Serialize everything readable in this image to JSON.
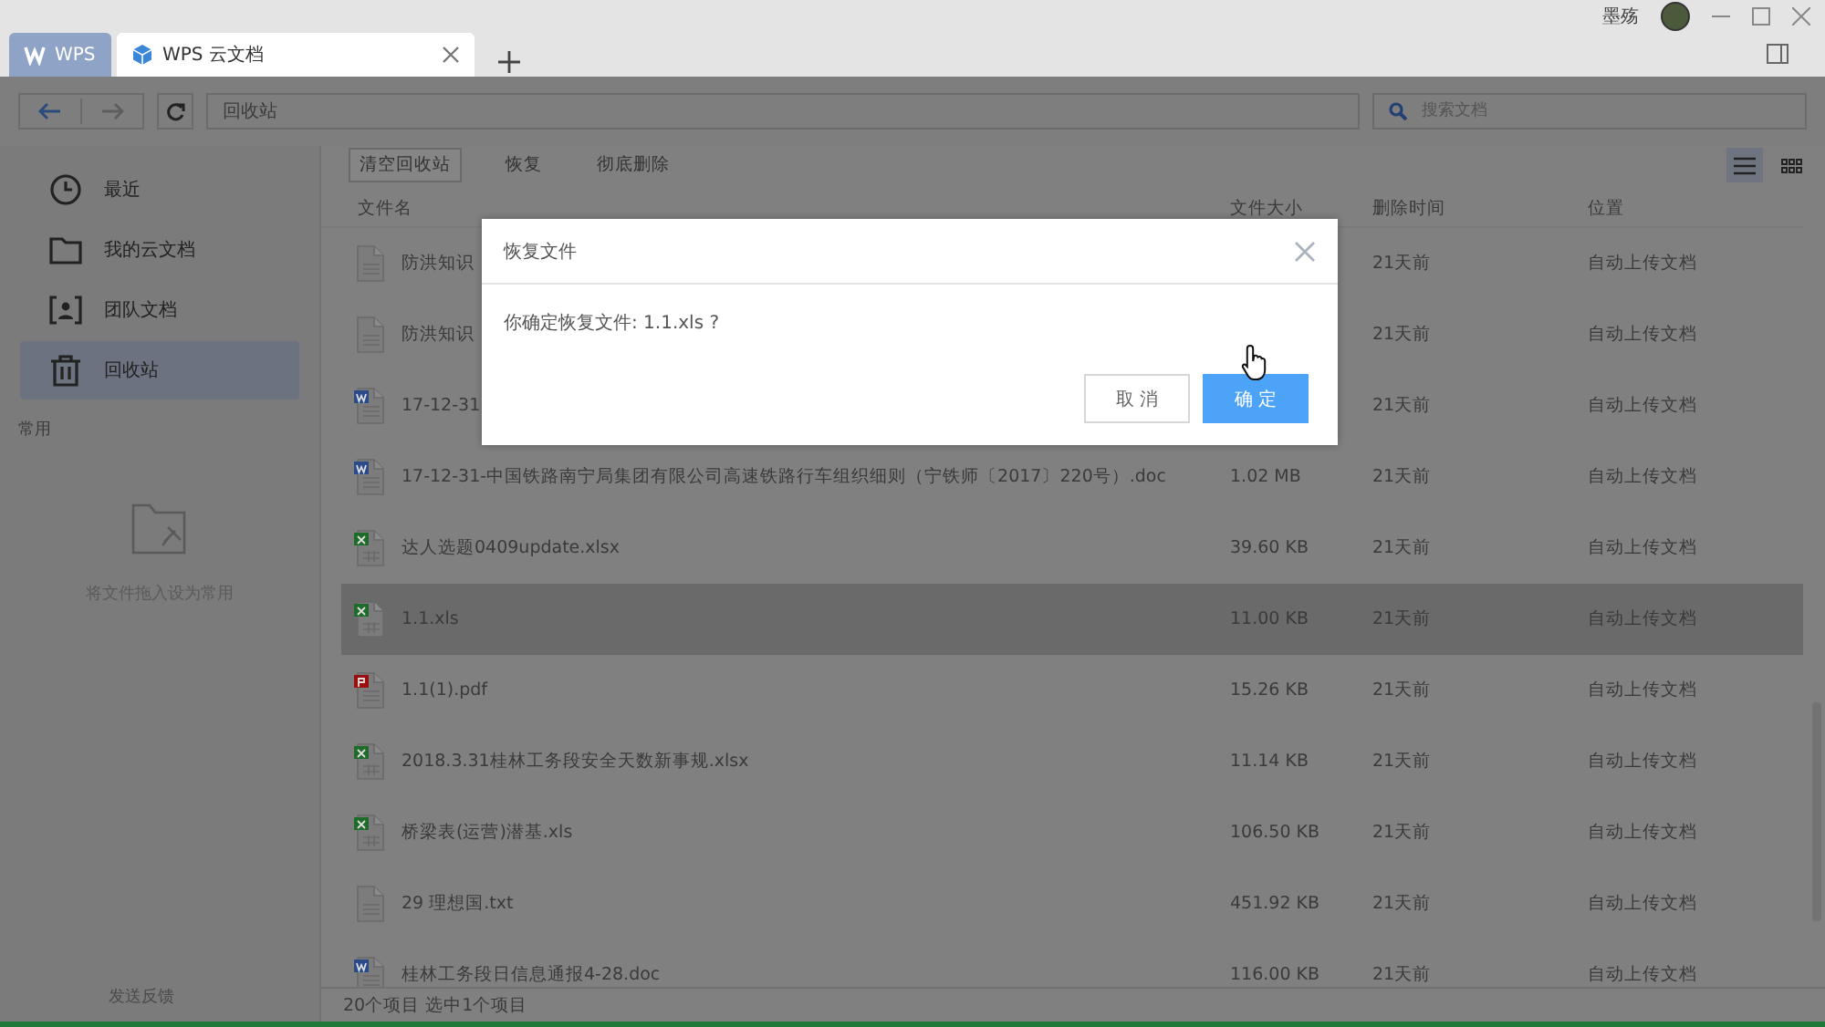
{
  "tabs": [
    {
      "label": "WPS",
      "kind": "home",
      "selected": false
    },
    {
      "label": "WPS 云文档",
      "kind": "doc",
      "selected": true
    }
  ],
  "user": {
    "name": "墨殇"
  },
  "address": "回收站",
  "search": {
    "placeholder": "搜索文档"
  },
  "sidebar": {
    "items": [
      {
        "label": "最近",
        "kind": "clock",
        "selected": false
      },
      {
        "label": "我的云文档",
        "kind": "folder",
        "selected": false
      },
      {
        "label": "团队文档",
        "kind": "team",
        "selected": false
      },
      {
        "label": "回收站",
        "kind": "trash",
        "selected": true
      }
    ],
    "section": "常用",
    "empty_hint": "将文件拖入设为常用",
    "feedback": "发送反馈"
  },
  "toolbar": [
    {
      "label": "清空回收站",
      "outlined": true
    },
    {
      "label": "恢复",
      "outlined": false
    },
    {
      "label": "彻底删除",
      "outlined": false
    }
  ],
  "views": [
    {
      "kind": "list",
      "selected": true
    },
    {
      "kind": "grid",
      "selected": false
    }
  ],
  "table": {
    "columns": [
      "文件名",
      "文件大小",
      "删除时间",
      "位置"
    ],
    "rows": [
      {
        "name": "防洪知识",
        "kind": "txt",
        "deleted": "21天前",
        "location": "自动上传文档",
        "selected": false
      },
      {
        "name": "防洪知识",
        "kind": "txt",
        "deleted": "21天前",
        "location": "自动上传文档",
        "selected": false
      },
      {
        "name": "17-12-31",
        "kind": "doc",
        "deleted": "21天前",
        "location": "自动上传文档",
        "selected": false
      },
      {
        "name": "17-12-31-中国铁路南宁局集团有限公司高速铁路行车组织细则（宁铁师〔2017〕220号）.doc",
        "kind": "doc",
        "size": "1.02 MB",
        "deleted": "21天前",
        "location": "自动上传文档",
        "selected": false
      },
      {
        "name": "达人选题0409update.xlsx",
        "kind": "xls",
        "size": "39.60 KB",
        "deleted": "21天前",
        "location": "自动上传文档",
        "selected": false
      },
      {
        "name": "1.1.xls",
        "kind": "xls",
        "size": "11.00 KB",
        "deleted": "21天前",
        "location": "自动上传文档",
        "selected": true
      },
      {
        "name": "1.1(1).pdf",
        "kind": "pdf",
        "size": "15.26 KB",
        "deleted": "21天前",
        "location": "自动上传文档",
        "selected": false
      },
      {
        "name": "2018.3.31桂林工务段安全天数新事规.xlsx",
        "kind": "xls",
        "size": "11.14 KB",
        "deleted": "21天前",
        "location": "自动上传文档",
        "selected": false
      },
      {
        "name": "桥梁表(运营)潜基.xls",
        "kind": "xls",
        "size": "106.50 KB",
        "deleted": "21天前",
        "location": "自动上传文档",
        "selected": false
      },
      {
        "name": "29 理想国.txt",
        "kind": "txt",
        "size": "451.92 KB",
        "deleted": "21天前",
        "location": "自动上传文档",
        "selected": false
      },
      {
        "name": "桂林工务段日信息通报4-28.doc",
        "kind": "doc",
        "size": "116.00 KB",
        "deleted": "21天前",
        "location": "自动上传文档",
        "selected": false
      }
    ]
  },
  "status": "20个项目 选中1个项目",
  "dialog": {
    "title": "恢复文件",
    "message": "你确定恢复文件: 1.1.xls ?",
    "buttons": [
      {
        "label": "取 消",
        "primary": false
      },
      {
        "label": "确 定",
        "primary": true
      }
    ]
  }
}
